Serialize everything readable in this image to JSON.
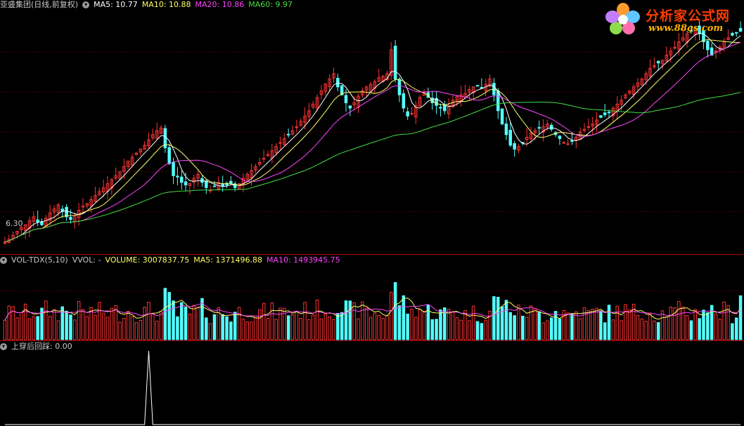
{
  "main_legend": {
    "title": "亚盛集团(日线,前复权)",
    "ma5": "MA5: 10.77",
    "ma10": "MA10: 10.88",
    "ma20": "MA20: 10.86",
    "ma60": "MA60: 9.97",
    "colors": {
      "title": "#c8c8c8",
      "ma5": "#ffffff",
      "ma10": "#ffff66",
      "ma20": "#ff44ff",
      "ma60": "#44dd44"
    }
  },
  "low_label": "6.30",
  "vol_legend": {
    "title": "VOL-TDX(5,10)",
    "vvol": "VVOL: -",
    "volume": "VOLUME: 3007837.75",
    "ma5": "MA5: 1371496.88",
    "ma10": "MA10: 1493945.75",
    "colors": {
      "volume": "#ffff66",
      "ma5": "#ffff66",
      "ma10": "#ff44ff"
    }
  },
  "ind_legend": {
    "title": "上穿后回踩",
    "value": ": 0.00"
  },
  "watermark": {
    "line1": "分析家公式网",
    "line2": "www.88gs.com"
  },
  "icons": [
    "menu-circle-icon",
    "flower-logo-icon"
  ],
  "chart_data": [
    {
      "type": "candlestick",
      "name": "price",
      "ylim": [
        6.0,
        15.0
      ],
      "up_color": "#ff3333",
      "down_color": "#54ffff",
      "low_label": 6.3,
      "closes": [
        6.35,
        6.45,
        6.6,
        6.75,
        6.9,
        7.0,
        7.15,
        7.3,
        7.1,
        7.0,
        7.25,
        7.45,
        7.6,
        7.75,
        7.5,
        7.3,
        7.2,
        7.35,
        7.55,
        7.7,
        7.8,
        7.95,
        8.1,
        8.25,
        8.4,
        8.55,
        8.7,
        8.85,
        9.0,
        9.2,
        9.4,
        9.55,
        9.7,
        9.85,
        10.0,
        10.2,
        10.4,
        10.55,
        10.65,
        9.9,
        9.3,
        8.85,
        8.8,
        8.6,
        8.5,
        8.55,
        8.75,
        8.9,
        8.6,
        8.4,
        8.3,
        8.45,
        8.6,
        8.45,
        8.5,
        8.55,
        8.4,
        8.55,
        8.75,
        8.9,
        9.05,
        9.2,
        9.35,
        9.5,
        9.65,
        9.8,
        9.95,
        10.1,
        10.25,
        10.4,
        10.55,
        10.7,
        10.9,
        11.1,
        11.3,
        11.55,
        11.8,
        12.05,
        12.3,
        12.5,
        12.7,
        12.2,
        11.9,
        11.6,
        11.4,
        11.6,
        11.85,
        12.05,
        12.2,
        12.3,
        12.4,
        12.55,
        12.6,
        12.7,
        13.6,
        12.5,
        11.9,
        11.4,
        11.1,
        11.2,
        11.5,
        11.8,
        12.0,
        11.8,
        11.6,
        11.5,
        11.4,
        11.3,
        11.5,
        11.7,
        11.85,
        11.9,
        11.95,
        12.1,
        12.2,
        12.25,
        12.15,
        12.3,
        12.5,
        11.9,
        11.3,
        10.8,
        10.4,
        10.0,
        9.85,
        9.95,
        10.1,
        10.3,
        10.45,
        10.55,
        10.65,
        10.7,
        10.8,
        10.6,
        10.4,
        10.25,
        10.1,
        10.05,
        10.15,
        10.3,
        10.5,
        10.6,
        10.7,
        10.8,
        10.95,
        11.05,
        11.15,
        11.25,
        11.4,
        11.55,
        11.7,
        11.9,
        12.05,
        12.2,
        12.35,
        12.5,
        12.7,
        12.9,
        13.0,
        13.1,
        13.2,
        13.4,
        13.55,
        13.7,
        13.9,
        14.05,
        14.2,
        14.3,
        14.4,
        14.2,
        13.9,
        13.6,
        13.4,
        13.55,
        13.7,
        13.9,
        14.05,
        14.15,
        14.25,
        14.3
      ],
      "ma_periods": [
        5,
        10,
        20,
        60
      ],
      "ma_colors": [
        "#ffffff",
        "#ffff66",
        "#ff44ff",
        "#44dd44"
      ]
    },
    {
      "type": "bar",
      "name": "volume",
      "ylim": [
        0,
        5000000
      ],
      "up_color": "#ff3333",
      "down_color": "#54ffff",
      "ma_periods": [
        5,
        10
      ],
      "ma_colors": [
        "#ffff66",
        "#ff44ff"
      ],
      "last_volume": 3007837.75,
      "last_ma5": 1371496.88,
      "last_ma10": 1493945.75
    },
    {
      "type": "line",
      "name": "上穿后回踩",
      "ylim": [
        0,
        1
      ],
      "color": "#ffffff",
      "signal_index": 35,
      "signal_value": 1,
      "last_value": 0.0
    }
  ]
}
